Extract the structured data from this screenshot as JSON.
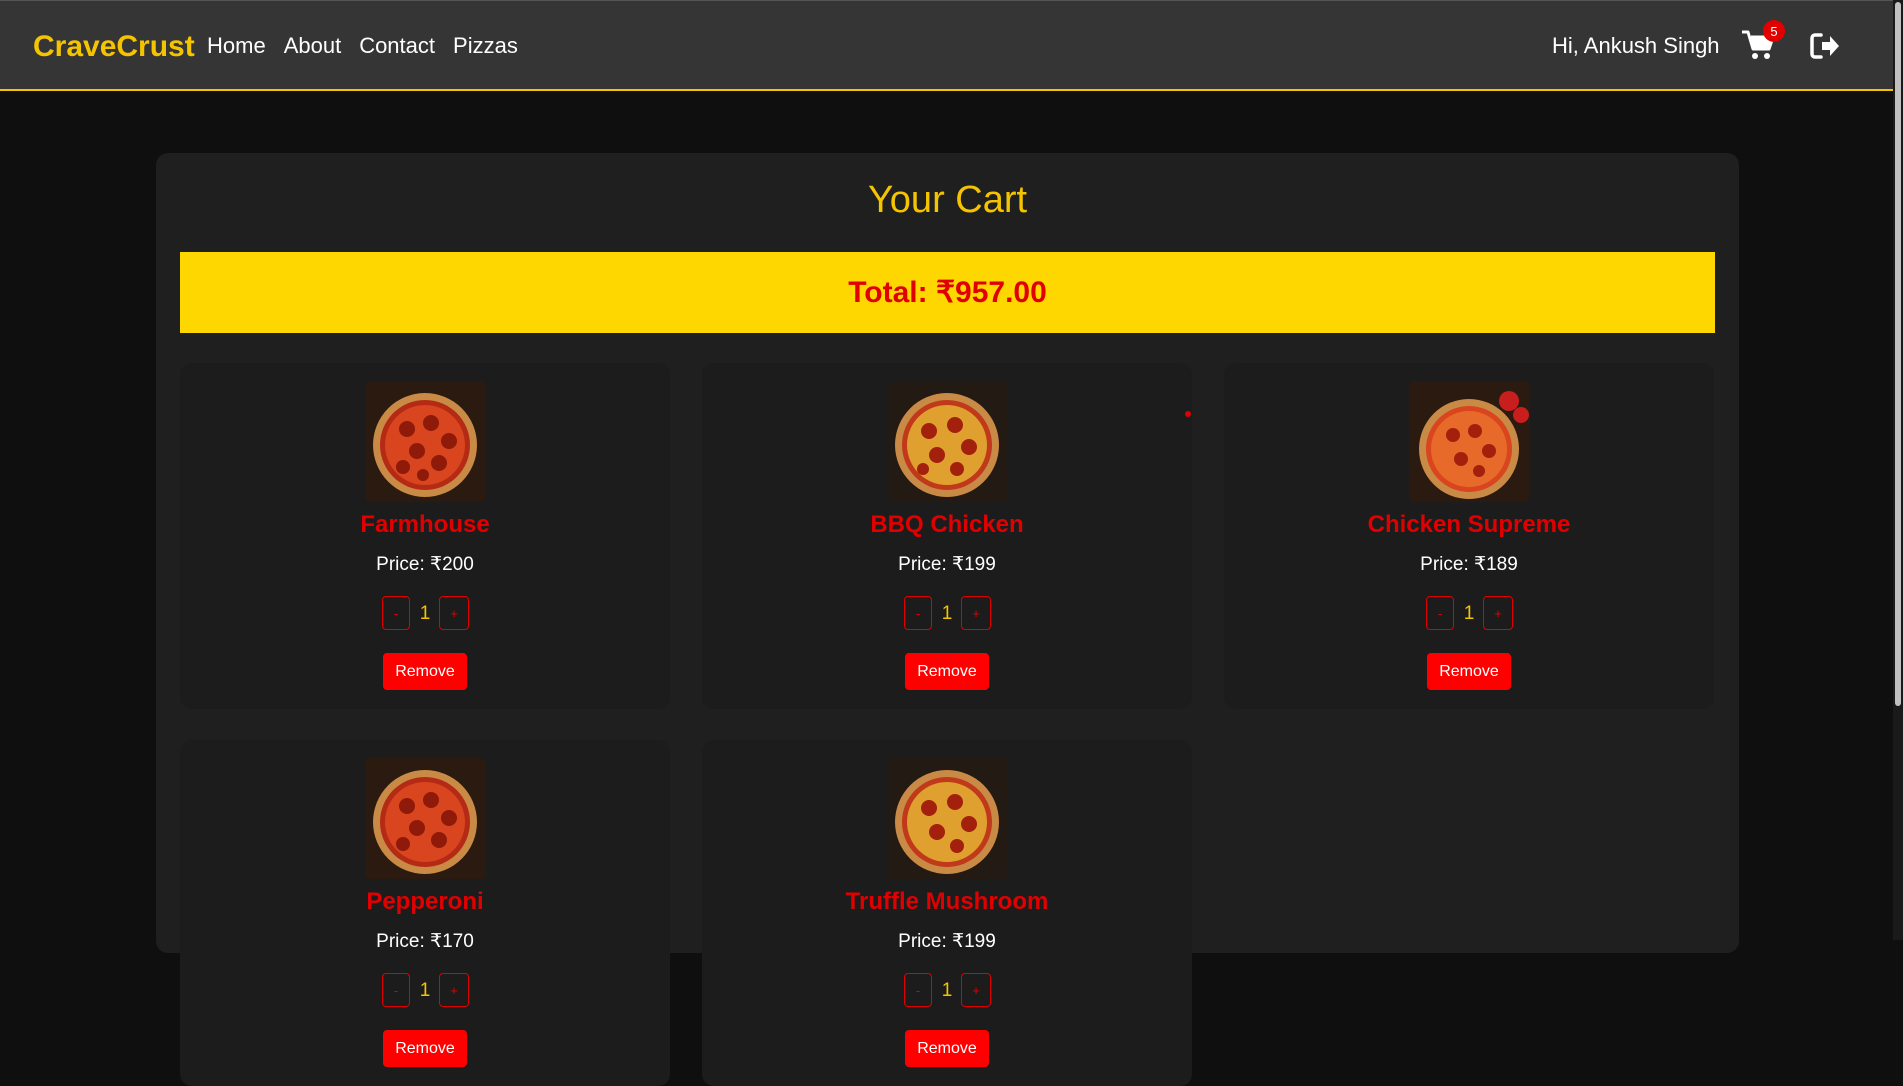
{
  "navbar": {
    "brand": "CraveCrust",
    "links": [
      "Home",
      "About",
      "Contact",
      "Pizzas"
    ],
    "greeting": "Hi, Ankush Singh",
    "cart_count": "5",
    "cart_icon": "shopping-cart-icon",
    "logout_icon": "sign-out-icon"
  },
  "cart": {
    "title": "Your Cart",
    "total": "Total: ₹957.00",
    "remove_label": "Remove",
    "minus_label": "-",
    "plus_label": "+",
    "items": [
      {
        "name": "Farmhouse",
        "price": "Price: ₹200",
        "qty": "1"
      },
      {
        "name": "BBQ Chicken",
        "price": "Price: ₹199",
        "qty": "1"
      },
      {
        "name": "Chicken Supreme",
        "price": "Price: ₹189",
        "qty": "1"
      },
      {
        "name": "Pepperoni",
        "price": "Price: ₹170",
        "qty": "1"
      },
      {
        "name": "Truffle Mushroom",
        "price": "Price: ₹199",
        "qty": "1"
      }
    ]
  },
  "colors": {
    "accent": "#f5c400",
    "danger": "#ff0000",
    "background": "#0f0f0f",
    "navbar": "#353535"
  }
}
